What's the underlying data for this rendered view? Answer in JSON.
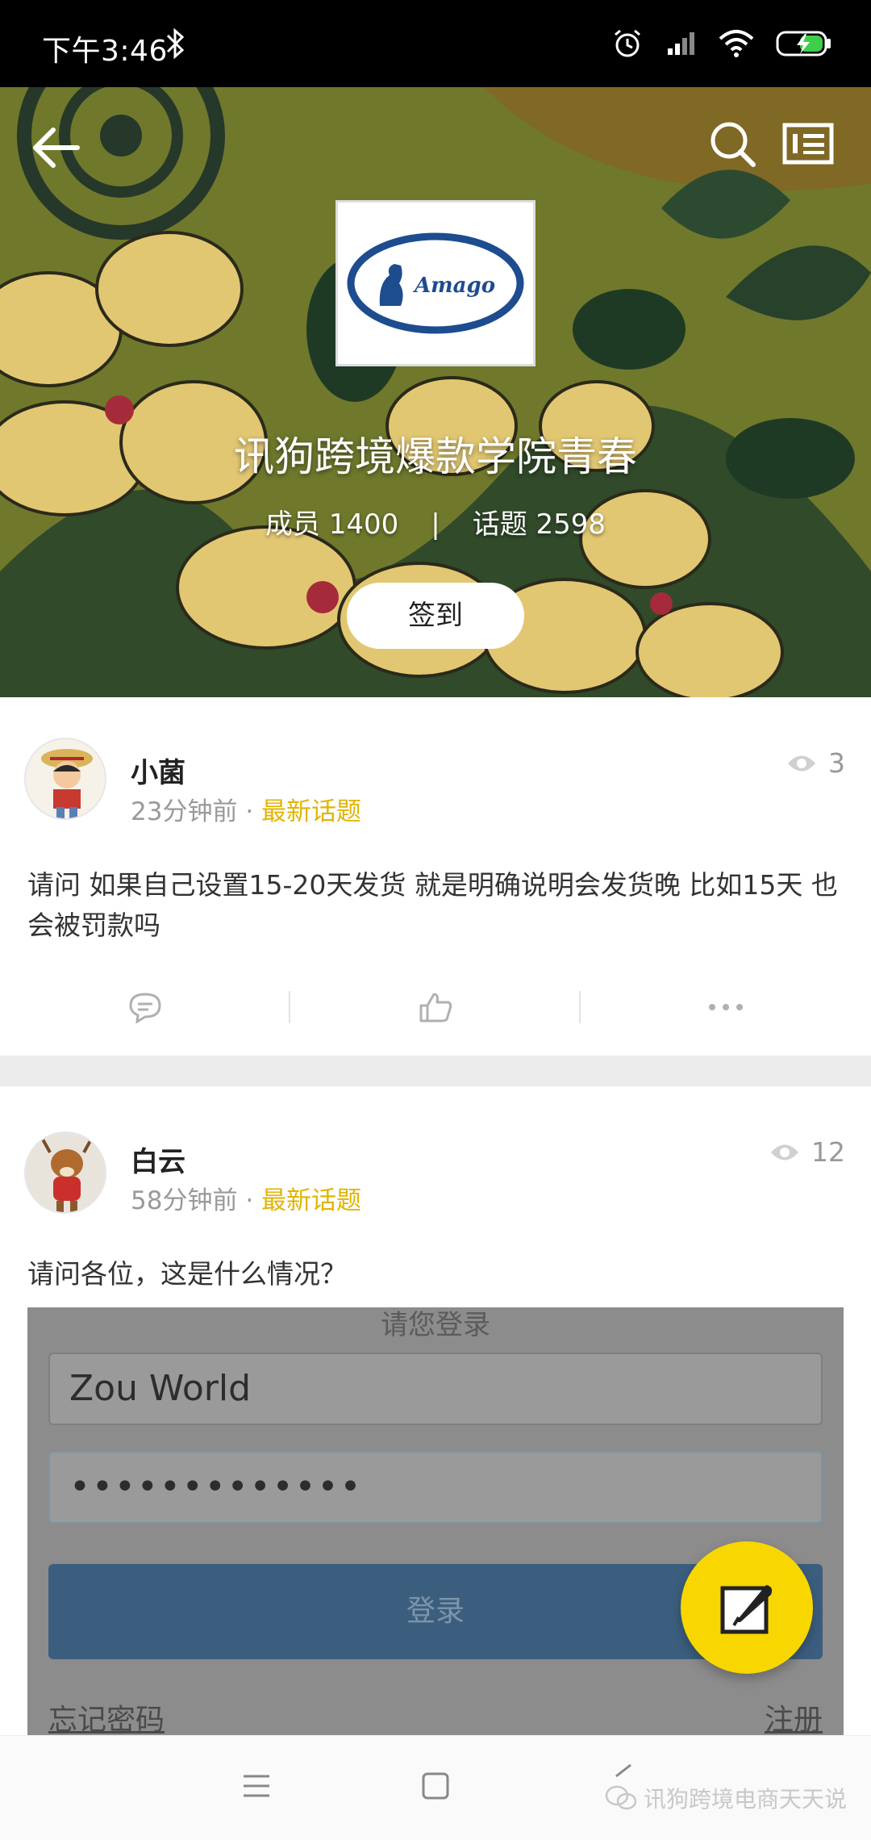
{
  "status_bar": {
    "time": "下午3:46"
  },
  "group": {
    "name": "讯狗跨境爆款学院青春",
    "members_label": "成员 1400",
    "separator": "|",
    "topics_label": "话题 2598",
    "checkin_label": "签到",
    "logo_text": "Amago"
  },
  "posts": [
    {
      "author": "小菌",
      "time": "23分钟前",
      "dot": "·",
      "tag": "最新话题",
      "views": "3",
      "text": "请问 如果自己设置15-20天发货 就是明确说明会发货晚 比如15天 也会被罚款吗"
    },
    {
      "author": "白云",
      "time": "58分钟前",
      "dot": "·",
      "tag": "最新话题",
      "views": "12",
      "text": "请问各位，这是什么情况？",
      "embed": {
        "title": "请您登录",
        "username": "Zou World",
        "password": "•••••••••••••",
        "login_label": "登录",
        "forgot_label": "忘记密码",
        "register_label": "注册"
      }
    }
  ],
  "watermark": "讯狗跨境电商天天说",
  "colors": {
    "accent": "#f8d600",
    "tag": "#e2b400",
    "status_bar": "#000000"
  }
}
